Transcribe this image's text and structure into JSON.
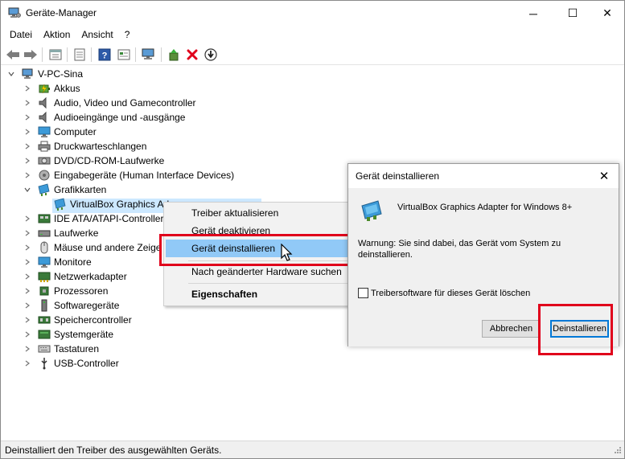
{
  "window": {
    "title": "Geräte-Manager",
    "minimize_glyph": "─",
    "maximize_glyph": "☐",
    "close_glyph": "✕"
  },
  "menu": [
    "Datei",
    "Aktion",
    "Ansicht",
    "?"
  ],
  "toolbar": {
    "icons": [
      "back-arrow-icon",
      "forward-arrow-icon",
      "properties-icon",
      "view-icon",
      "help-icon",
      "action-view-icon",
      "computer-scan-icon",
      "update-driver-icon",
      "uninstall-x-icon",
      "download-icon"
    ],
    "uninstall_color": "#e0001b"
  },
  "tree": {
    "root": "V-PC-Sina",
    "items": [
      {
        "label": "Akkus",
        "icon": "battery-icon"
      },
      {
        "label": "Audio, Video und Gamecontroller",
        "icon": "speaker-icon"
      },
      {
        "label": "Audioeingänge und -ausgänge",
        "icon": "speaker-icon"
      },
      {
        "label": "Computer",
        "icon": "monitor-icon"
      },
      {
        "label": "Druckwarteschlangen",
        "icon": "printer-icon"
      },
      {
        "label": "DVD/CD-ROM-Laufwerke",
        "icon": "disc-drive-icon"
      },
      {
        "label": "Eingabegeräte (Human Interface Devices)",
        "icon": "hid-icon"
      },
      {
        "label": "Grafikkarten",
        "icon": "display-adapter-icon"
      },
      {
        "label": "VirtualBox Graphics Ad",
        "icon": "display-adapter-icon"
      },
      {
        "label": "IDE ATA/ATAPI-Controller",
        "icon": "ide-controller-icon"
      },
      {
        "label": "Laufwerke",
        "icon": "drive-icon"
      },
      {
        "label": "Mäuse und andere Zeige",
        "icon": "mouse-icon"
      },
      {
        "label": "Monitore",
        "icon": "monitor-icon"
      },
      {
        "label": "Netzwerkadapter",
        "icon": "network-adapter-icon"
      },
      {
        "label": "Prozessoren",
        "icon": "processor-icon"
      },
      {
        "label": "Softwaregeräte",
        "icon": "software-device-icon"
      },
      {
        "label": "Speichercontroller",
        "icon": "storage-controller-icon"
      },
      {
        "label": "Systemgeräte",
        "icon": "system-device-icon"
      },
      {
        "label": "Tastaturen",
        "icon": "keyboard-icon"
      },
      {
        "label": "USB-Controller",
        "icon": "usb-icon"
      }
    ]
  },
  "context_menu": {
    "items": [
      "Treiber aktualisieren",
      "Gerät deaktivieren",
      "Gerät deinstallieren",
      "Nach geänderter Hardware suchen",
      "Eigenschaften"
    ],
    "highlight_color": "#91c9f7"
  },
  "dialog": {
    "title": "Gerät deinstallieren",
    "close_glyph": "✕",
    "device_name": "VirtualBox Graphics Adapter for Windows 8+",
    "warning": "Warnung: Sie sind dabei, das Gerät vom System zu deinstallieren.",
    "checkbox_label": "Treibersoftware für dieses Gerät löschen",
    "cancel_label": "Abbrechen",
    "ok_label": "Deinstallieren"
  },
  "status": {
    "text": "Deinstalliert den Treiber des ausgewählten Geräts."
  },
  "accent": "#e0001b"
}
